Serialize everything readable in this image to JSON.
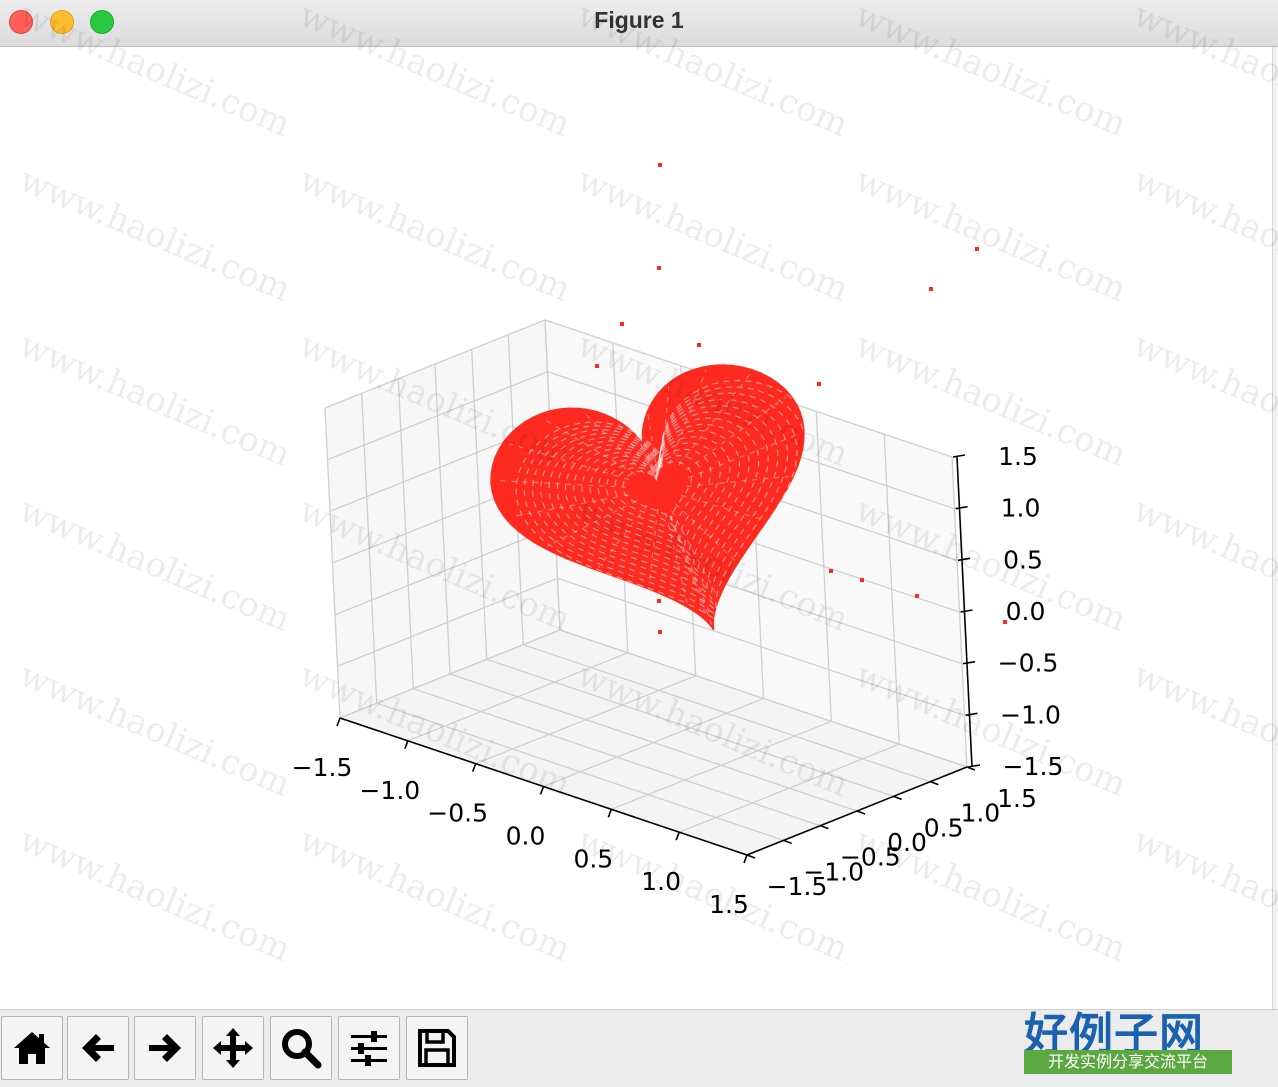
{
  "window": {
    "title": "Figure 1"
  },
  "figure": {
    "color": "#ff2a1f",
    "axis_color": "#000000",
    "grid_color": "#cfcfcf",
    "pane_color": "#f4f4f4"
  },
  "chart_data": {
    "type": "surface3d",
    "title": "",
    "description_color": "red",
    "x_ticks": [
      "−1.5",
      "−1.0",
      "−0.5",
      "0.0",
      "0.5",
      "1.0",
      "1.5"
    ],
    "y_ticks": [
      "−1.5",
      "−1.0",
      "−0.5",
      "0.0",
      "0.5",
      "1.0",
      "1.5"
    ],
    "z_ticks": [
      "−1.5",
      "−1.0",
      "−0.5",
      "0.0",
      "0.5",
      "1.0",
      "1.5"
    ],
    "xlim": [
      -1.5,
      1.5
    ],
    "ylim": [
      -1.5,
      1.5
    ],
    "zlim": [
      -1.5,
      1.5
    ],
    "grid": true
  },
  "toolbar": {
    "buttons": [
      {
        "name": "home",
        "icon": "home-icon"
      },
      {
        "name": "back",
        "icon": "arrow-left-icon"
      },
      {
        "name": "forward",
        "icon": "arrow-right-icon"
      },
      {
        "name": "pan",
        "icon": "move-icon"
      },
      {
        "name": "zoom",
        "icon": "magnifier-icon"
      },
      {
        "name": "configure-subplots",
        "icon": "sliders-icon"
      },
      {
        "name": "save",
        "icon": "floppy-icon"
      }
    ]
  },
  "watermark": {
    "text": "www.haolizi.com"
  },
  "brand": {
    "name": "好例子网",
    "slogan": "开发实例分享交流平台"
  }
}
